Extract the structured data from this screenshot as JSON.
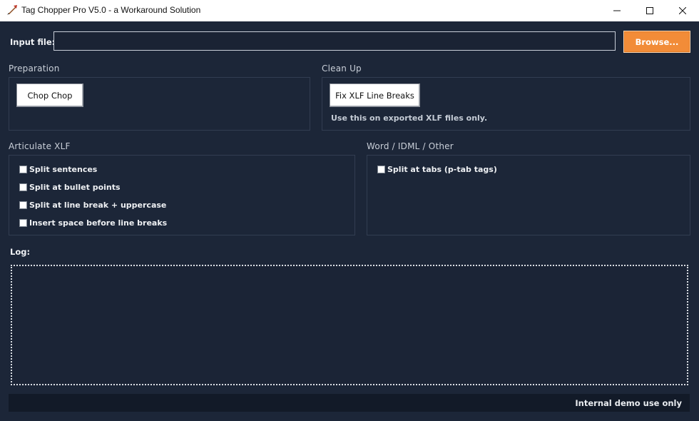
{
  "window": {
    "title": "Tag Chopper Pro V5.0 - a Workaround Solution",
    "app_icon": "quill-icon",
    "controls": [
      "minimize-icon",
      "maximize-icon",
      "close-icon"
    ]
  },
  "input": {
    "label": "Input file:",
    "value": "",
    "browse_label": "Browse..."
  },
  "preparation": {
    "title": "Preparation",
    "button_label": "Chop Chop"
  },
  "cleanup": {
    "title": "Clean Up",
    "button_label": "Fix XLF Line Breaks",
    "hint": "Use this on exported XLF files only."
  },
  "articulate": {
    "title": "Articulate XLF",
    "options": [
      {
        "label": "Split sentences",
        "checked": false
      },
      {
        "label": "Split at bullet points",
        "checked": false
      },
      {
        "label": "Split at line break + uppercase",
        "checked": false
      },
      {
        "label": "Insert space before line breaks",
        "checked": false
      }
    ]
  },
  "word": {
    "title": "Word / IDML / Other",
    "options": [
      {
        "label": "Split at tabs (p-tab tags)",
        "checked": false
      }
    ]
  },
  "log": {
    "label": "Log:",
    "content": ""
  },
  "status": {
    "text": "Internal demo use only"
  },
  "colors": {
    "background": "#1c2638",
    "accent": "#f28c38",
    "frame_border": "#323d51",
    "statusbar": "#121a28"
  }
}
